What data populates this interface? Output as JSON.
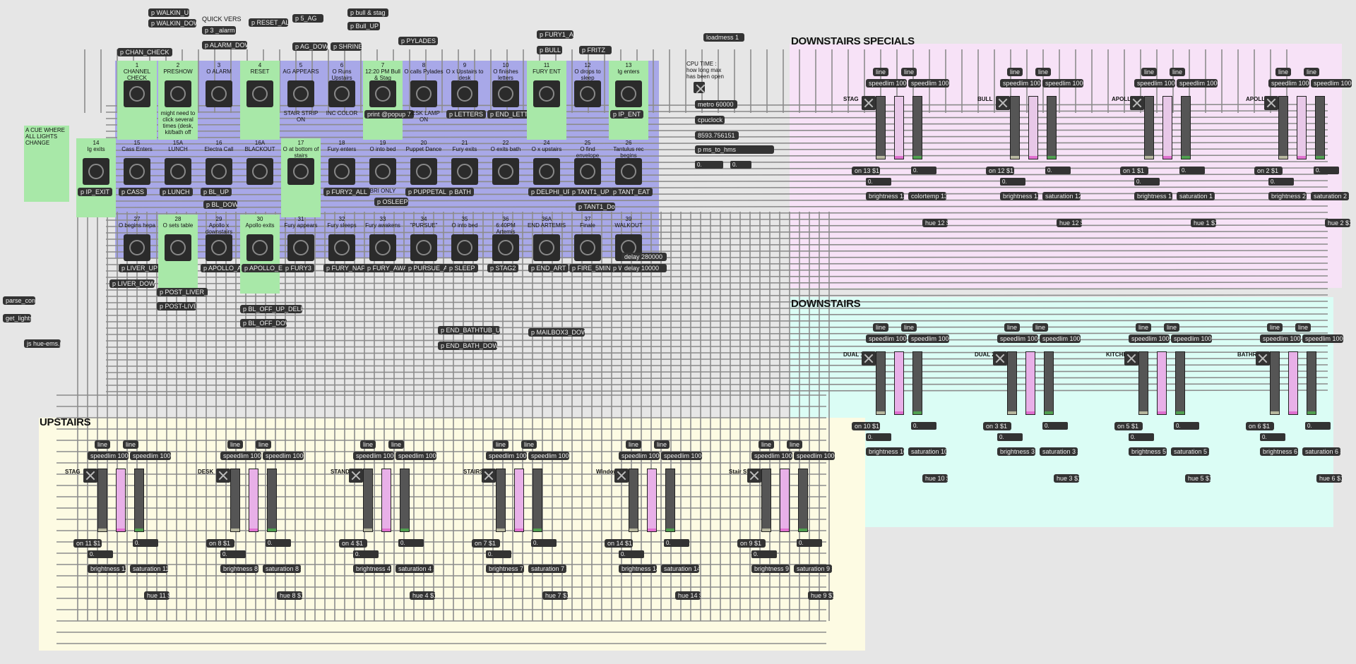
{
  "colors": {
    "bg": "#e6e6e6",
    "panel_yellow": "#fdfbe3",
    "panel_pink": "#f7e2f7",
    "panel_cyan": "#dbfdf5",
    "cue_green": "#a8e8a8",
    "cue_blue": "#a8a8e8",
    "patch_wire": "#8c8c8c",
    "object": "#333333"
  },
  "section_titles": {
    "downstairs_specials": "DOWNSTAIRS SPECIALS",
    "downstairs": "DOWNSTAIRS",
    "upstairs": "UPSTAIRS"
  },
  "top_left_objects": [
    "p WALKIN_UP",
    "p WALKIN_DOWN",
    "QUICK VERSION",
    "p 3 _alarm",
    "p ALARM_DOWN",
    "p RESET_ALL",
    "p 5_AG",
    "p AG_DOWN",
    "p SHRINE",
    "p bull & stag",
    "p Bull_UP",
    "p PYLADES",
    "p CHAN_CHECK",
    "p FURY1_ALL",
    "p BULL",
    "p FRITZ",
    "loadmess 1"
  ],
  "side_objects": [
    "parse_config",
    "get_lights",
    "js hue-ems.js"
  ],
  "cpu": {
    "note": "CPU TIME : how long max has been open",
    "metro": "metro 60000",
    "cpuclock": "cpuclock",
    "value": "8593.756151",
    "ms": "p ms_to_hms",
    "n1": "0.",
    "n2": "0."
  },
  "cue_note": "A CUE WHERE ALL LIGHTS CHANGE",
  "cues_row1": [
    {
      "label": "1\nCHANNEL CHECK",
      "color": "green",
      "sub": ""
    },
    {
      "label": "2\nPRESHOW",
      "color": "green",
      "sub": "might need to click several times (desk, kit/bath off"
    },
    {
      "label": "3\nO ALARM",
      "color": "blue",
      "sub": ""
    },
    {
      "label": "4\nRESET",
      "color": "green",
      "sub": ""
    },
    {
      "label": "5\nAG APPEARS",
      "color": "blue",
      "sub": "STAIR STRIP ON"
    },
    {
      "label": "6\nO Runs Upstairs",
      "color": "blue",
      "sub": "INC COLOR"
    },
    {
      "label": "7\n12:20 PM Bull & Stag",
      "color": "green",
      "sub": "print @popup 7"
    },
    {
      "label": "8\nO calls Pylades",
      "color": "blue",
      "sub": "DESK LAMP ON"
    },
    {
      "label": "9\nO x Upstairs to desk",
      "color": "blue",
      "sub": "p LETTERS"
    },
    {
      "label": "10\nO finishes letters",
      "color": "blue",
      "sub": "p END_LETTERS"
    },
    {
      "label": "11\nFURY ENT",
      "color": "green",
      "sub": ""
    },
    {
      "label": "12\nO drops to sleep",
      "color": "blue",
      "sub": ""
    },
    {
      "label": "13\nIg enters",
      "color": "green",
      "sub": "p IP_ENT"
    }
  ],
  "cues_row2": [
    {
      "label": "14\nIg exits",
      "color": "green",
      "sub": "p IP_EXIT"
    },
    {
      "label": "15\nCass Enters",
      "color": "blue",
      "sub": "p CASS"
    },
    {
      "label": "15A\nLUNCH",
      "color": "blue",
      "sub": "p LUNCH"
    },
    {
      "label": "16\nElectra Call",
      "color": "blue",
      "sub": "p BL_UP"
    },
    {
      "label": "16A\nBLACKOUT",
      "color": "blue",
      "sub": ""
    },
    {
      "label": "17\nO at bottom of stairs",
      "color": "green",
      "sub": ""
    },
    {
      "label": "18\nFury enters",
      "color": "blue",
      "sub": "p FURY2_ALL"
    },
    {
      "label": "19\nO into bed",
      "color": "blue",
      "sub": "BRI ONLY"
    },
    {
      "label": "20\nPuppet Dance",
      "color": "blue",
      "sub": "p PUPPETALL"
    },
    {
      "label": "21\nFury exits",
      "color": "blue",
      "sub": "p BATH"
    },
    {
      "label": "22\nO exits bath",
      "color": "blue",
      "sub": ""
    },
    {
      "label": "24\nO x upstairs",
      "color": "blue",
      "sub": "p DELPHI_UP"
    },
    {
      "label": "25\nO find envelope",
      "color": "blue",
      "sub": "p TANT1_UP"
    },
    {
      "label": "26\nTantulus rec begins",
      "color": "blue",
      "sub": "p TANT_EAT"
    }
  ],
  "cues_row3": [
    {
      "label": "27\nO begins hepa",
      "color": "blue",
      "sub": "p LIVER_UP"
    },
    {
      "label": "28\nO sets table",
      "color": "green",
      "sub": ""
    },
    {
      "label": "29\nApollo x downstairs",
      "color": "blue",
      "sub": "p APOLLO_ALL"
    },
    {
      "label": "30\nApollo exits",
      "color": "green",
      "sub": "p APOLLO_EXIT"
    },
    {
      "label": "31\nFury appears",
      "color": "blue",
      "sub": "p FURY3"
    },
    {
      "label": "32\nFury sleeps",
      "color": "blue",
      "sub": "p FURY_NAP"
    },
    {
      "label": "33\nFury awakens",
      "color": "blue",
      "sub": "p FURY_AWAKE"
    },
    {
      "label": "34\n\"PURSUE\"",
      "color": "blue",
      "sub": "p PURSUE_ALL"
    },
    {
      "label": "35\nO into bed",
      "color": "blue",
      "sub": "p SLEEP"
    },
    {
      "label": "36\n6:40PM Artemis",
      "color": "blue",
      "sub": "p STAG2"
    },
    {
      "label": "36A\nEND ARTEMIS",
      "color": "blue",
      "sub": "p END_ART"
    },
    {
      "label": "37\nFinale",
      "color": "blue",
      "sub": "p FIRE_5MIN"
    },
    {
      "label": "39\nWALKOUT",
      "color": "blue",
      "sub": "p WALKOUT"
    }
  ],
  "misc_objects": [
    "p BL_DOWN",
    "p OSLEEP",
    "p TANT1_Down",
    "delay 280000",
    "delay 10000",
    "p LIVER_DOWN",
    "p POST_LIVER_UP",
    "p POST-LIVER",
    "p BL_OFF_UP_DELPHI2",
    "p BL_OFF_DOWN",
    "p END_BATHTUB_UP",
    "p END_BATH_DOWN",
    "p MAILBOX3_DOWN"
  ],
  "specials_lanes": [
    {
      "name": "STAG",
      "on": "on 13 $1",
      "bri": "brightness 13 $1",
      "extra": "colortemp 13 $1",
      "hue": "hue 12 $1"
    },
    {
      "name": "BULL",
      "on": "on 12 $1",
      "bri": "brightness 12 $1",
      "sat": "saturation 12 $1",
      "hue": "hue 12 $1"
    },
    {
      "name": "APOLLO",
      "on": "on 1 $1",
      "bri": "brightness 1 $1",
      "sat": "saturation 1 $1",
      "hue": "hue 1 $1"
    },
    {
      "name": "APOLLO CLOS",
      "on": "on 2 $1",
      "bri": "brightness 2 $1",
      "sat": "saturation 2 $1",
      "hue": "hue 2 $1"
    }
  ],
  "downstairs_lanes": [
    {
      "name": "DUAL 1",
      "on": "on 10 $1",
      "bri": "brightness 10 $1",
      "sat": "saturation 10 $1",
      "hue": "hue 10 $1"
    },
    {
      "name": "DUAL 2",
      "on": "on 3 $1",
      "bri": "brightness 3 $1",
      "sat": "saturation 3 $1",
      "hue": "hue 3 $1"
    },
    {
      "name": "KITCHEN",
      "on": "on 5 $1",
      "bri": "brightness 5 $1",
      "sat": "saturation 5 $1",
      "hue": "hue 5 $1"
    },
    {
      "name": "BATHROOM",
      "on": "on 6 $1",
      "bri": "brightness 6 $1",
      "sat": "saturation 6 $1",
      "hue": "hue 6 $1"
    }
  ],
  "upstairs_lanes": [
    {
      "name": "STAG",
      "on": "on 11 $1",
      "bri": "brightness 11 $1",
      "sat": "saturation 11 $1",
      "hue": "hue 11 $1"
    },
    {
      "name": "DESK",
      "on": "on 8 $1",
      "bri": "brightness 8 $1",
      "sat": "saturation 8 $1",
      "hue": "hue 8 $1"
    },
    {
      "name": "STANDING",
      "on": "on 4 $1",
      "bri": "brightness 4 $1",
      "sat": "saturation 4 $1",
      "hue": "hue 4 $1"
    },
    {
      "name": "STAIRS",
      "on": "on 7 $1",
      "bri": "brightness 7 $1",
      "sat": "saturation 7 $1",
      "hue": "hue 7 $1"
    },
    {
      "name": "Window Strip",
      "on": "on 14 $1",
      "bri": "brightness 14 $1",
      "sat": "saturation 14 $1",
      "hue": "hue 14 $1"
    },
    {
      "name": "Stair Strip",
      "on": "on 9 $1",
      "bri": "brightness 9 $1",
      "sat": "saturation 9 $1",
      "hue": "hue 9 $1"
    }
  ],
  "lane_common": {
    "line": "line",
    "speedlim": "speedlim 1000",
    "num": "0."
  }
}
